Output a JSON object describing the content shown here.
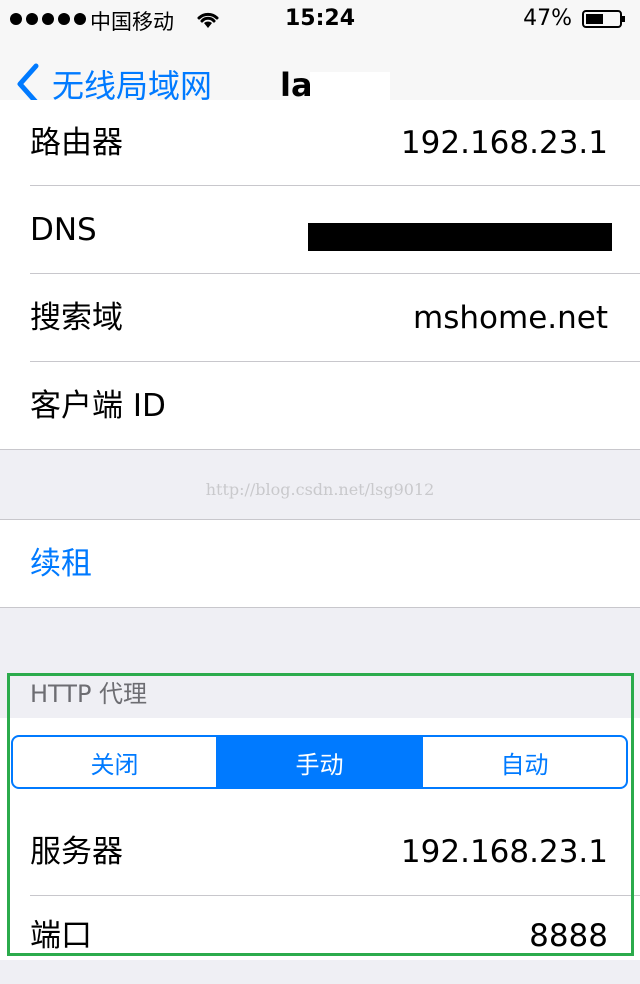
{
  "status_bar": {
    "carrier": "中国移动",
    "time": "15:24",
    "battery": "47%"
  },
  "nav": {
    "back_label": "无线局域网",
    "title": "la"
  },
  "dhcp_rows": [
    {
      "label": "路由器",
      "value": "192.168.23.1"
    },
    {
      "label": "DNS",
      "value": ""
    },
    {
      "label": "搜索域",
      "value": "mshome.net"
    },
    {
      "label": "客户端 ID",
      "value": ""
    }
  ],
  "watermark": "http://blog.csdn.net/lsg9012",
  "renew_label": "续租",
  "http_proxy": {
    "header": "HTTP 代理",
    "segments": [
      "关闭",
      "手动",
      "自动"
    ],
    "selected": "手动",
    "rows": [
      {
        "label": "服务器",
        "value": "192.168.23.1"
      },
      {
        "label": "端口",
        "value": "8888"
      }
    ]
  },
  "colors": {
    "accent": "#007aff",
    "highlight_border": "#2bab4c"
  }
}
